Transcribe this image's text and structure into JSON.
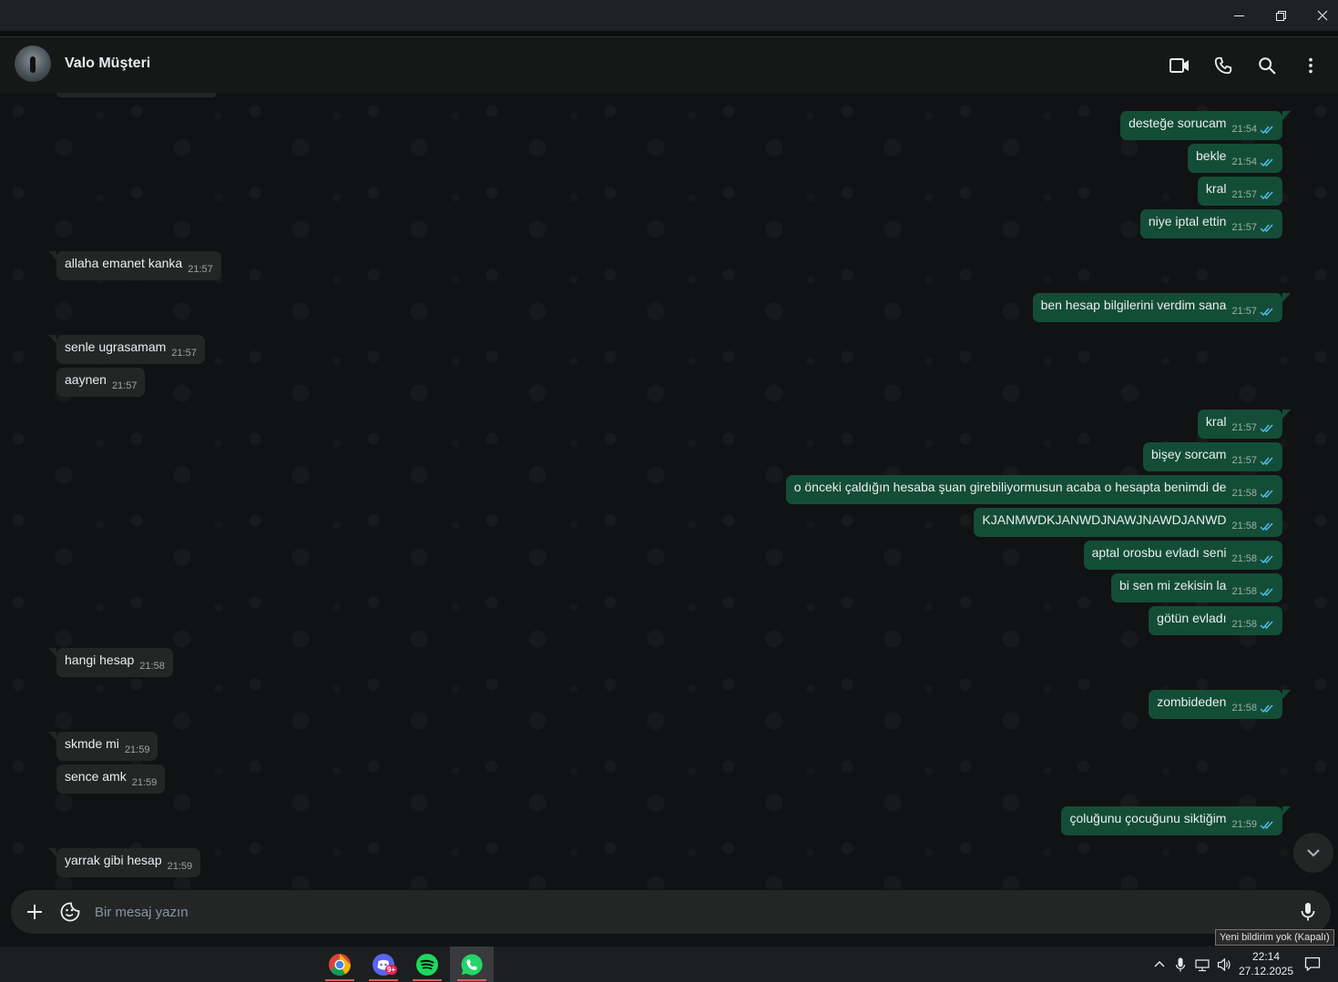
{
  "contact": {
    "name": "Valo Müşteri"
  },
  "composer": {
    "placeholder": "Bir mesaj yazın"
  },
  "messages": [
    {
      "dir": "out",
      "text": "desteğe sorucam",
      "time": "21:54"
    },
    {
      "dir": "out",
      "text": "bekle",
      "time": "21:54"
    },
    {
      "dir": "out",
      "text": "kral",
      "time": "21:57"
    },
    {
      "dir": "out",
      "text": "niye iptal ettin",
      "time": "21:57"
    },
    {
      "dir": "in",
      "text": "allaha emanet kanka",
      "time": "21:57"
    },
    {
      "dir": "out",
      "text": "ben hesap bilgilerini verdim sana",
      "time": "21:57"
    },
    {
      "dir": "in",
      "text": "senle ugrasamam",
      "time": "21:57"
    },
    {
      "dir": "in",
      "text": "aaynen",
      "time": "21:57"
    },
    {
      "dir": "out",
      "text": "kral",
      "time": "21:57"
    },
    {
      "dir": "out",
      "text": "bişey sorcam",
      "time": "21:57"
    },
    {
      "dir": "out",
      "text": "o önceki çaldığın hesaba şuan girebiliyormusun acaba o hesapta benimdi de",
      "time": "21:58"
    },
    {
      "dir": "out",
      "text": "KJANMWDKJANWDJNAWJNAWDJANWD",
      "time": "21:58"
    },
    {
      "dir": "out",
      "text": "aptal orosbu evladı seni",
      "time": "21:58"
    },
    {
      "dir": "out",
      "text": "bi sen mi zekisin la",
      "time": "21:58"
    },
    {
      "dir": "out",
      "text": "götün evladı",
      "time": "21:58"
    },
    {
      "dir": "in",
      "text": "hangi hesap",
      "time": "21:58"
    },
    {
      "dir": "out",
      "text": "zombideden",
      "time": "21:58"
    },
    {
      "dir": "in",
      "text": "skmde mi",
      "time": "21:59"
    },
    {
      "dir": "in",
      "text": "sence amk",
      "time": "21:59"
    },
    {
      "dir": "out",
      "text": "çoluğunu çocuğunu siktiğim",
      "time": "21:59"
    },
    {
      "dir": "in",
      "text": "yarrak gibi hesap",
      "time": "21:59"
    }
  ],
  "tooltip": {
    "text": "Yeni bildirim yok (Kapalı)"
  },
  "taskbar": {
    "apps": [
      {
        "name": "Chrome",
        "icon": "chrome-icon"
      },
      {
        "name": "Discord",
        "icon": "discord-icon",
        "badge": "9+"
      },
      {
        "name": "Spotify",
        "icon": "spotify-icon"
      },
      {
        "name": "WhatsApp",
        "icon": "whatsapp-icon",
        "active": true
      }
    ],
    "clock": {
      "time": "22:14",
      "date": "27.12.2025"
    }
  },
  "colors": {
    "outgoing_bubble": "#144d37",
    "incoming_bubble": "#242626",
    "read_tick": "#53bdeb",
    "background": "#111213"
  }
}
